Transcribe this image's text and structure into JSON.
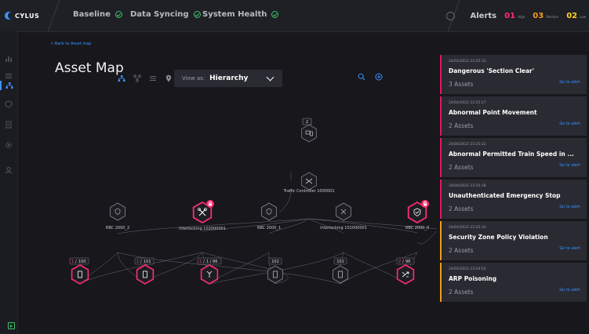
{
  "brand": {
    "name": "CYLUS"
  },
  "topbar": {
    "nav": [
      {
        "label": "Baseline",
        "icon": "check-circle-icon"
      },
      {
        "label": "Data Syncing",
        "icon": "check-circle-icon"
      },
      {
        "label": "System Health",
        "icon": "check-circle-icon"
      }
    ],
    "alerts": {
      "title": "Alerts",
      "high": {
        "count": "01",
        "label": "High",
        "color": "#ff2d6e"
      },
      "medium": {
        "count": "03",
        "label": "Medium",
        "color": "#f29c1f"
      },
      "low": {
        "count": "02",
        "label": "Low",
        "color": "#ffd21a"
      }
    }
  },
  "sidebar": {
    "icons": [
      "bar-chart-icon",
      "list-icon",
      "hierarchy-icon",
      "shield-icon",
      "document-icon",
      "settings-icon",
      "user-icon"
    ],
    "active": "hierarchy-icon"
  },
  "main": {
    "back_link": "< Back to Asset map",
    "title": "Asset Map",
    "view_icons": [
      "hierarchy-icon",
      "network-icon",
      "list-icon",
      "location-pin-icon"
    ],
    "view_select": {
      "label": "View as:",
      "value": "Hierarchy"
    }
  },
  "graph": {
    "top_count": "2",
    "traffic_controller": "Traffic Controller 1000001",
    "mid_nodes": [
      {
        "label": "RBC 2000_2",
        "alert": false
      },
      {
        "label": "Interlocking 102000001",
        "alert": true
      },
      {
        "label": "RBC 2000_1",
        "alert": false
      },
      {
        "label": "Interlocking 101000001",
        "alert": false
      },
      {
        "label": "RBC 2000_0",
        "alert": true
      }
    ],
    "bottom_nodes": [
      {
        "alert_count": "1",
        "total": "100",
        "alert": true
      },
      {
        "alert_count": "1",
        "total": "101",
        "alert": true
      },
      {
        "alert_count": "1",
        "total": "1 / 96",
        "alert": true
      },
      {
        "alert_count": "",
        "total": "102",
        "alert": false
      },
      {
        "alert_count": "",
        "total": "102",
        "alert": false
      },
      {
        "alert_count": "2",
        "total": "98",
        "alert": true
      }
    ]
  },
  "alerts_panel": [
    {
      "time": "24/04/2022 23:25:33",
      "title": "Dangerous 'Section Clear'",
      "assets": "3 Assets",
      "link": "Go to alert",
      "severity": "high"
    },
    {
      "time": "24/04/2022 23:25:27",
      "title": "Abnormal Point Movement",
      "assets": "2 Assets",
      "link": "Go to alert",
      "severity": "high"
    },
    {
      "time": "24/04/2022 23:25:22",
      "title": "Abnormal Permitted Train Speed in ...",
      "assets": "2 Assets",
      "link": "Go to alert",
      "severity": "high"
    },
    {
      "time": "24/04/2022 23:25:18",
      "title": "Unauthenticated Emergency Stop",
      "assets": "2 Assets",
      "link": "Go to alert",
      "severity": "high"
    },
    {
      "time": "24/04/2022 23:25:10",
      "title": "Security Zone Policy Violation",
      "assets": "2 Assets",
      "link": "Go to alert",
      "severity": "medium"
    },
    {
      "time": "24/04/2022 23:24:54",
      "title": "ARP Poisoning",
      "assets": "2 Assets",
      "link": "Go to alert",
      "severity": "medium"
    }
  ]
}
